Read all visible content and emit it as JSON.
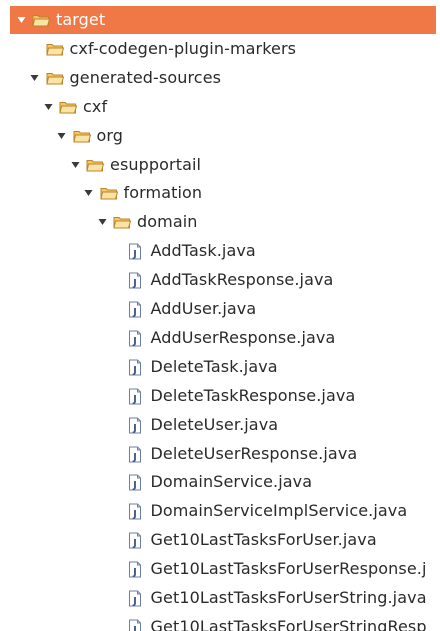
{
  "tree": {
    "items": [
      {
        "label": "target",
        "type": "folder",
        "expanded": true,
        "selected": true,
        "depth": 0
      },
      {
        "label": "cxf-codegen-plugin-markers",
        "type": "folder",
        "expanded": false,
        "selected": false,
        "depth": 1
      },
      {
        "label": "generated-sources",
        "type": "folder",
        "expanded": true,
        "selected": false,
        "depth": 1
      },
      {
        "label": "cxf",
        "type": "folder",
        "expanded": true,
        "selected": false,
        "depth": 2
      },
      {
        "label": "org",
        "type": "folder",
        "expanded": true,
        "selected": false,
        "depth": 3
      },
      {
        "label": "esupportail",
        "type": "folder",
        "expanded": true,
        "selected": false,
        "depth": 4
      },
      {
        "label": "formation",
        "type": "folder",
        "expanded": true,
        "selected": false,
        "depth": 5
      },
      {
        "label": "domain",
        "type": "folder",
        "expanded": true,
        "selected": false,
        "depth": 6
      },
      {
        "label": "AddTask.java",
        "type": "java-file",
        "selected": false,
        "depth": 7
      },
      {
        "label": "AddTaskResponse.java",
        "type": "java-file",
        "selected": false,
        "depth": 7
      },
      {
        "label": "AddUser.java",
        "type": "java-file",
        "selected": false,
        "depth": 7
      },
      {
        "label": "AddUserResponse.java",
        "type": "java-file",
        "selected": false,
        "depth": 7
      },
      {
        "label": "DeleteTask.java",
        "type": "java-file",
        "selected": false,
        "depth": 7
      },
      {
        "label": "DeleteTaskResponse.java",
        "type": "java-file",
        "selected": false,
        "depth": 7
      },
      {
        "label": "DeleteUser.java",
        "type": "java-file",
        "selected": false,
        "depth": 7
      },
      {
        "label": "DeleteUserResponse.java",
        "type": "java-file",
        "selected": false,
        "depth": 7
      },
      {
        "label": "DomainService.java",
        "type": "java-file",
        "selected": false,
        "depth": 7
      },
      {
        "label": "DomainServiceImplService.java",
        "type": "java-file",
        "selected": false,
        "depth": 7
      },
      {
        "label": "Get10LastTasksForUser.java",
        "type": "java-file",
        "selected": false,
        "depth": 7
      },
      {
        "label": "Get10LastTasksForUserResponse.j",
        "type": "java-file",
        "selected": false,
        "depth": 7
      },
      {
        "label": "Get10LastTasksForUserString.java",
        "type": "java-file",
        "selected": false,
        "depth": 7
      },
      {
        "label": "Get10LastTasksForUserStringResp",
        "type": "java-file",
        "selected": false,
        "depth": 7
      }
    ]
  },
  "colors": {
    "selection": "#f07746",
    "folder": "#f0a830",
    "text": "#2a2a2a"
  },
  "icons": {
    "folder": "folder-icon",
    "java-file": "java-file-icon",
    "expanded": "chevron-down-icon"
  }
}
